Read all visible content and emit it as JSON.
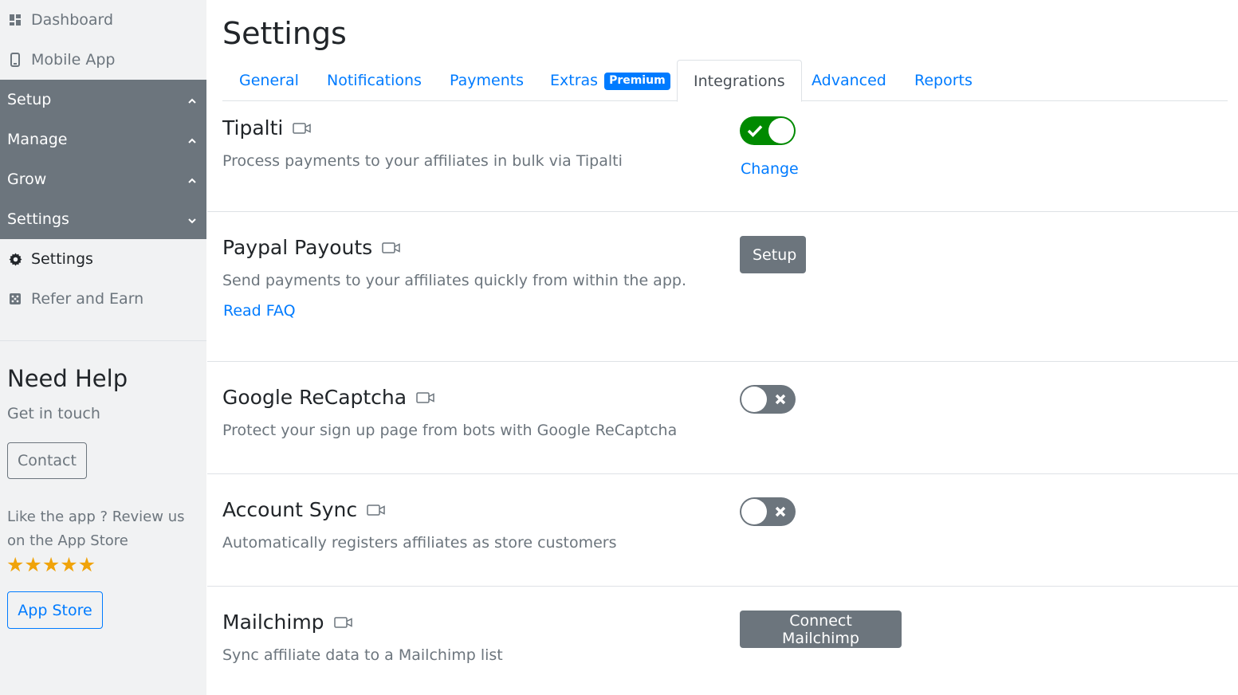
{
  "sidebar": {
    "top_items": [
      {
        "label": "Dashboard",
        "icon": "dashboard-icon"
      },
      {
        "label": "Mobile App",
        "icon": "mobile-icon"
      }
    ],
    "groups": [
      {
        "label": "Setup",
        "chevron": "up"
      },
      {
        "label": "Manage",
        "chevron": "up"
      },
      {
        "label": "Grow",
        "chevron": "up"
      },
      {
        "label": "Settings",
        "chevron": "down"
      }
    ],
    "sub_items": [
      {
        "label": "Settings",
        "icon": "gear-icon",
        "active": true
      },
      {
        "label": "Refer and Earn",
        "icon": "dice-icon",
        "active": false
      }
    ],
    "help": {
      "title": "Need Help",
      "subtitle": "Get in touch",
      "contact_label": "Contact",
      "review_text": "Like the app ? Review us on the App Store",
      "stars": "★★★★★",
      "appstore_label": "App Store"
    }
  },
  "page": {
    "title": "Settings"
  },
  "tabs": [
    {
      "label": "General"
    },
    {
      "label": "Notifications"
    },
    {
      "label": "Payments"
    },
    {
      "label": "Extras",
      "badge": "Premium"
    },
    {
      "label": "Integrations",
      "active": true
    },
    {
      "label": "Advanced"
    },
    {
      "label": "Reports"
    }
  ],
  "integrations": {
    "tipalti": {
      "title": "Tipalti",
      "description": "Process payments to your affiliates in bulk via Tipalti",
      "enabled": true,
      "change_label": "Change"
    },
    "paypal": {
      "title": "Paypal Payouts",
      "description": "Send payments to your affiliates quickly from within the app.",
      "faq_label": "Read FAQ",
      "setup_label": "Setup"
    },
    "recaptcha": {
      "title": "Google ReCaptcha",
      "description": "Protect your sign up page from bots with Google ReCaptcha",
      "enabled": false
    },
    "account_sync": {
      "title": "Account Sync",
      "description": "Automatically registers affiliates as store customers",
      "enabled": false
    },
    "mailchimp": {
      "title": "Mailchimp",
      "description": "Sync affiliate data to a Mailchimp list",
      "connect_label": "Connect Mailchimp"
    }
  },
  "colors": {
    "accent": "#007bff",
    "sidebar_group": "#6c757d",
    "toggle_on": "#008a00",
    "toggle_off": "#6c757d",
    "stars": "#f0a30a"
  }
}
